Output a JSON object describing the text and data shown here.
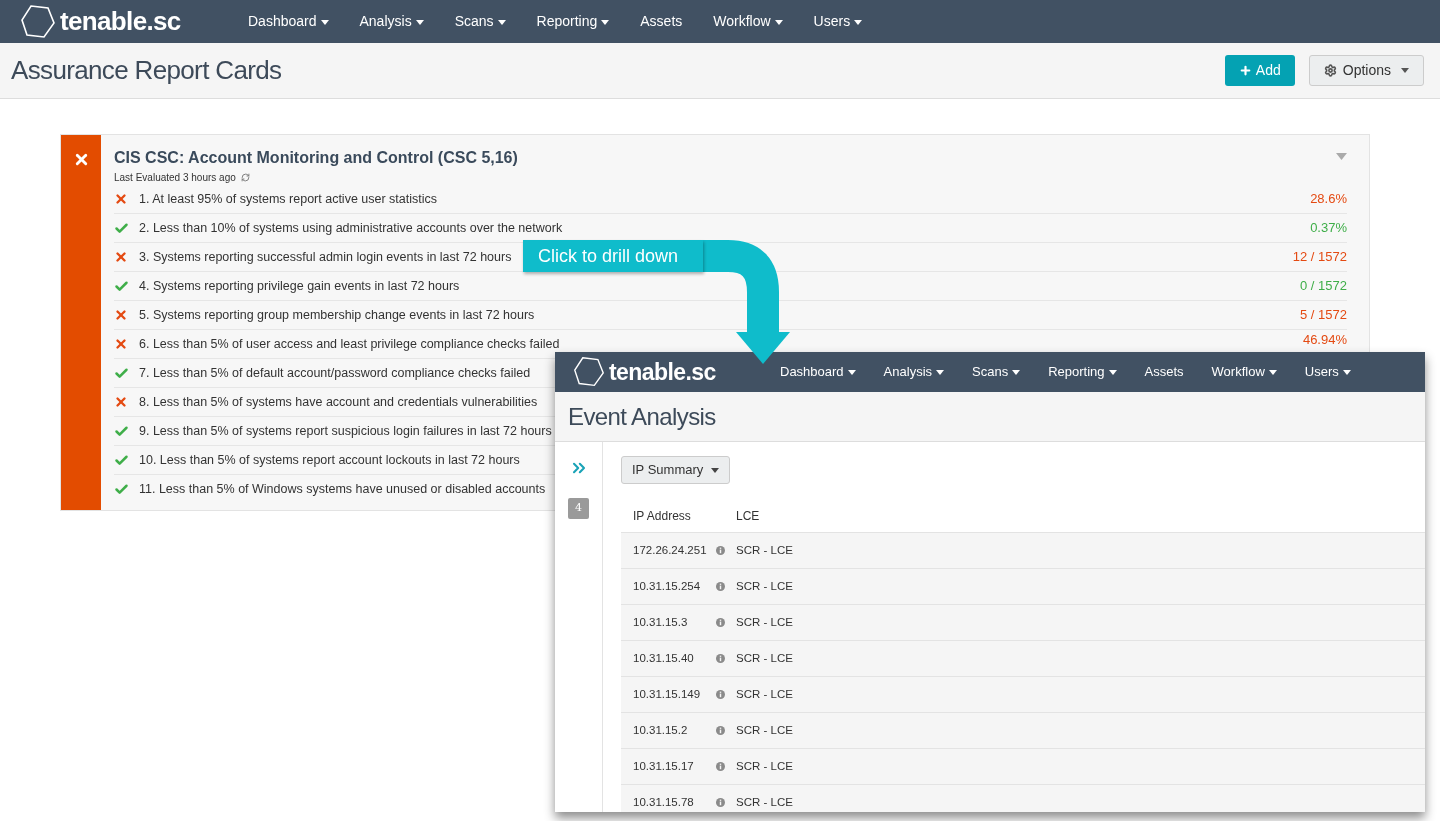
{
  "navbar": {
    "logo": "tenable.sc",
    "items": [
      {
        "label": "Dashboard",
        "dropdown": true
      },
      {
        "label": "Analysis",
        "dropdown": true
      },
      {
        "label": "Scans",
        "dropdown": true
      },
      {
        "label": "Reporting",
        "dropdown": true
      },
      {
        "label": "Assets",
        "dropdown": false
      },
      {
        "label": "Workflow",
        "dropdown": true
      },
      {
        "label": "Users",
        "dropdown": true
      }
    ]
  },
  "page_title": "Assurance Report Cards",
  "buttons": {
    "add": "Add",
    "options": "Options"
  },
  "card": {
    "passed": false,
    "title": "CIS CSC: Account Monitoring and Control (CSC 5,16)",
    "last_evaluated": "Last Evaluated 3 hours ago",
    "rows": [
      {
        "passed": false,
        "text": "1. At least 95% of systems report active user statistics",
        "value": "28.6%"
      },
      {
        "passed": true,
        "text": "2. Less than 10% of systems using administrative accounts over the network",
        "value": "0.37%"
      },
      {
        "passed": false,
        "text": "3. Systems reporting successful admin login events in last 72 hours",
        "value": "12 / 1572"
      },
      {
        "passed": true,
        "text": "4. Systems reporting privilege gain events in last 72 hours",
        "value": "0 / 1572"
      },
      {
        "passed": false,
        "text": "5. Systems reporting group membership change events in last 72 hours",
        "value": "5 / 1572"
      },
      {
        "passed": false,
        "text": "6. Less than 5% of user access and least privilege compliance checks failed",
        "value": "46.94%"
      },
      {
        "passed": true,
        "text": "7. Less than 5% of default account/password compliance checks failed"
      },
      {
        "passed": false,
        "text": "8. Less than 5% of systems have account and credentials vulnerabilities"
      },
      {
        "passed": true,
        "text": "9. Less than 5% of systems report suspicious login failures in last 72 hours"
      },
      {
        "passed": true,
        "text": "10. Less than 5% of systems report account lockouts in last 72 hours"
      },
      {
        "passed": true,
        "text": "11. Less than 5% of Windows systems have unused or disabled accounts"
      }
    ]
  },
  "callout": "Click to drill down",
  "drilldown": {
    "navbar": {
      "logo": "tenable.sc",
      "items": [
        {
          "label": "Dashboard",
          "dropdown": true
        },
        {
          "label": "Analysis",
          "dropdown": true
        },
        {
          "label": "Scans",
          "dropdown": true
        },
        {
          "label": "Reporting",
          "dropdown": true
        },
        {
          "label": "Assets",
          "dropdown": false
        },
        {
          "label": "Workflow",
          "dropdown": true
        },
        {
          "label": "Users",
          "dropdown": true
        }
      ]
    },
    "page_title": "Event Analysis",
    "sidebar_badge": "4",
    "view_select": "IP Summary",
    "columns": [
      "IP Address",
      "LCE"
    ],
    "rows": [
      {
        "ip": "172.26.24.251",
        "lce": "SCR - LCE"
      },
      {
        "ip": "10.31.15.254",
        "lce": "SCR - LCE"
      },
      {
        "ip": "10.31.15.3",
        "lce": "SCR - LCE"
      },
      {
        "ip": "10.31.15.40",
        "lce": "SCR - LCE"
      },
      {
        "ip": "10.31.15.149",
        "lce": "SCR - LCE"
      },
      {
        "ip": "10.31.15.2",
        "lce": "SCR - LCE"
      },
      {
        "ip": "10.31.15.17",
        "lce": "SCR - LCE"
      },
      {
        "ip": "10.31.15.78",
        "lce": "SCR - LCE"
      }
    ]
  }
}
